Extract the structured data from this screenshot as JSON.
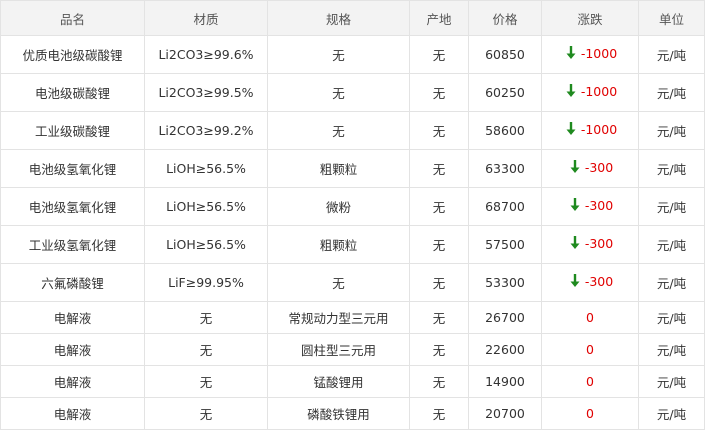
{
  "columns": [
    "品名",
    "材质",
    "规格",
    "产地",
    "价格",
    "涨跌",
    "单位"
  ],
  "colors": {
    "up_down_value": "#e00000",
    "down_arrow": "#1f8a1f",
    "header_bg": "#f3f3f3",
    "border": "#e3e3e3"
  },
  "rows": [
    {
      "name": "优质电池级碳酸锂",
      "material": "Li2CO3≥99.6%",
      "spec": "无",
      "origin": "无",
      "price": "60850",
      "change": "-1000",
      "trend": "down-arrow-icon",
      "unit": "元/吨"
    },
    {
      "name": "电池级碳酸锂",
      "material": "Li2CO3≥99.5%",
      "spec": "无",
      "origin": "无",
      "price": "60250",
      "change": "-1000",
      "trend": "down-arrow-icon",
      "unit": "元/吨"
    },
    {
      "name": "工业级碳酸锂",
      "material": "Li2CO3≥99.2%",
      "spec": "无",
      "origin": "无",
      "price": "58600",
      "change": "-1000",
      "trend": "down-arrow-icon",
      "unit": "元/吨"
    },
    {
      "name": "电池级氢氧化锂",
      "material": "LiOH≥56.5%",
      "spec": "粗颗粒",
      "origin": "无",
      "price": "63300",
      "change": "-300",
      "trend": "down-arrow-icon",
      "unit": "元/吨"
    },
    {
      "name": "电池级氢氧化锂",
      "material": "LiOH≥56.5%",
      "spec": "微粉",
      "origin": "无",
      "price": "68700",
      "change": "-300",
      "trend": "down-arrow-icon",
      "unit": "元/吨"
    },
    {
      "name": "工业级氢氧化锂",
      "material": "LiOH≥56.5%",
      "spec": "粗颗粒",
      "origin": "无",
      "price": "57500",
      "change": "-300",
      "trend": "down-arrow-icon",
      "unit": "元/吨"
    },
    {
      "name": "六氟磷酸锂",
      "material": "LiF≥99.95%",
      "spec": "无",
      "origin": "无",
      "price": "53300",
      "change": "-300",
      "trend": "down-arrow-icon",
      "unit": "元/吨"
    },
    {
      "name": "电解液",
      "material": "无",
      "spec": "常规动力型三元用",
      "origin": "无",
      "price": "26700",
      "change": "0",
      "trend": "",
      "unit": "元/吨"
    },
    {
      "name": "电解液",
      "material": "无",
      "spec": "圆柱型三元用",
      "origin": "无",
      "price": "22600",
      "change": "0",
      "trend": "",
      "unit": "元/吨"
    },
    {
      "name": "电解液",
      "material": "无",
      "spec": "锰酸锂用",
      "origin": "无",
      "price": "14900",
      "change": "0",
      "trend": "",
      "unit": "元/吨"
    },
    {
      "name": "电解液",
      "material": "无",
      "spec": "磷酸铁锂用",
      "origin": "无",
      "price": "20700",
      "change": "0",
      "trend": "",
      "unit": "元/吨"
    }
  ]
}
